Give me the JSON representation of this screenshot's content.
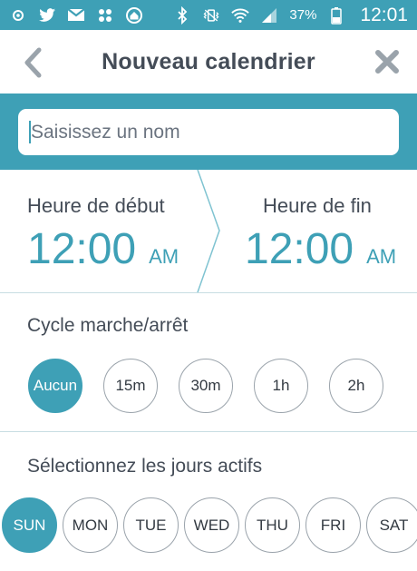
{
  "status_bar": {
    "left_icons": [
      "settings-icon",
      "twitter-icon",
      "gmail-icon",
      "pinwheel-icon",
      "home-icon"
    ],
    "right_icons": [
      "bluetooth-icon",
      "vibrate-icon",
      "wifi-icon",
      "signal-icon",
      "battery-icon"
    ],
    "battery": "37%",
    "time": "12:01"
  },
  "header": {
    "title": "Nouveau calendrier",
    "back_icon": "chevron-left-icon",
    "close_icon": "close-icon"
  },
  "name_field": {
    "placeholder": "Saisissez un nom",
    "value": ""
  },
  "time": {
    "start": {
      "label": "Heure de début",
      "value": "12:00",
      "period": "AM"
    },
    "end": {
      "label": "Heure de fin",
      "value": "12:00",
      "period": "AM"
    }
  },
  "cycle": {
    "title": "Cycle marche/arrêt",
    "options": [
      "Aucun",
      "15m",
      "30m",
      "1h",
      "2h"
    ],
    "selected": "Aucun"
  },
  "days": {
    "title": "Sélectionnez les jours actifs",
    "options": [
      "SUN",
      "MON",
      "TUE",
      "WED",
      "THU",
      "FRI",
      "SAT"
    ],
    "selected": [
      "SUN"
    ]
  },
  "colors": {
    "accent": "#3ea0b6",
    "text": "#444c57",
    "divider": "#c7dde2"
  }
}
